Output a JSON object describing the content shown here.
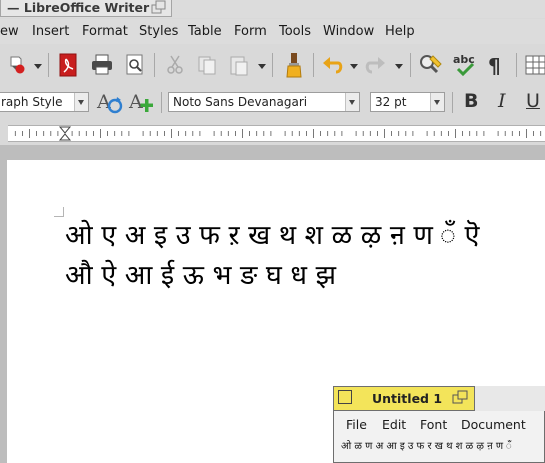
{
  "window": {
    "title": "— LibreOffice Writer"
  },
  "menubar": {
    "items": [
      {
        "label": "ew",
        "key": "view"
      },
      {
        "label": "Insert",
        "key": "insert"
      },
      {
        "label": "Format",
        "key": "format"
      },
      {
        "label": "Styles",
        "key": "styles"
      },
      {
        "label": "Table",
        "key": "table"
      },
      {
        "label": "Form",
        "key": "form"
      },
      {
        "label": "Tools",
        "key": "tools"
      },
      {
        "label": "Window",
        "key": "window"
      },
      {
        "label": "Help",
        "key": "help"
      }
    ]
  },
  "toolbar": {
    "icons": [
      "record-icon",
      "pdf-export-icon",
      "print-icon",
      "print-preview-icon",
      "cut-icon",
      "copy-icon",
      "paste-icon",
      "clone-formatting-icon",
      "undo-icon",
      "redo-icon",
      "find-replace-icon",
      "spelling-icon",
      "formatting-marks-icon",
      "insert-table-icon"
    ]
  },
  "formatbar": {
    "paragraph_style": "raph Style",
    "font_name": "Noto Sans Devanagari",
    "font_size": "32 pt",
    "bold_label": "B",
    "italic_label": "I",
    "underline_label": "U"
  },
  "document": {
    "line1": "ओ ए अ इ उ फ ऱ ख थ श ळ ऴ ऩ ण ँ ऎ",
    "line2": "औ ऐ आ ई ऊ भ ङ घ ध झ"
  },
  "secondary_window": {
    "title": "Untitled 1",
    "menu": [
      "File",
      "Edit",
      "Font",
      "Document"
    ],
    "text": "ओ ळ ण अ आ इ उ फ र ख थ श ळ ऴ ऩ ण ँ"
  },
  "colors": {
    "title_highlight": "#f3e45a",
    "chrome": "#d9d9d9",
    "page": "#ffffff"
  }
}
